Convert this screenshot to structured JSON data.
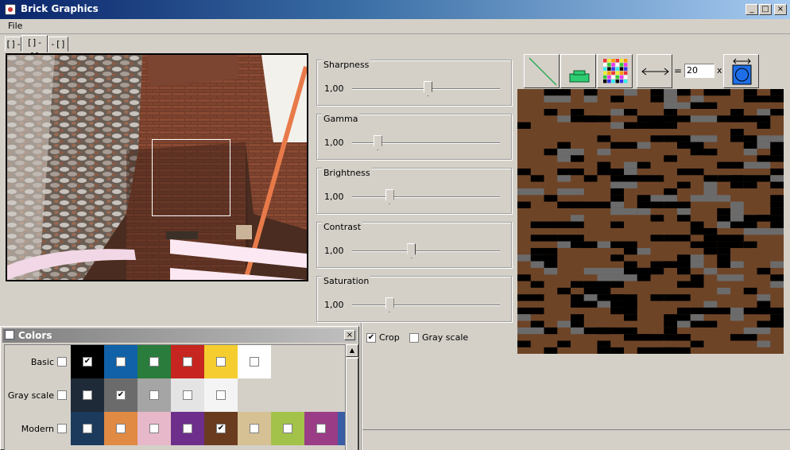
{
  "window": {
    "title": "Brick Graphics",
    "controls": {
      "minimize": "_",
      "maximize": "□",
      "close": "×"
    }
  },
  "menu": {
    "file": "File"
  },
  "tabs": [
    {
      "label": "[]-",
      "active": false
    },
    {
      "label": "[]-[]",
      "active": true
    },
    {
      "label": "-[]",
      "active": false
    }
  ],
  "sliders": [
    {
      "label": "Sharpness",
      "value": "1,00",
      "position": 0.51
    },
    {
      "label": "Gamma",
      "value": "1,00",
      "position": 0.17
    },
    {
      "label": "Brightness",
      "value": "1,00",
      "position": 0.25
    },
    {
      "label": "Contrast",
      "value": "1,00",
      "position": 0.4
    },
    {
      "label": "Saturation",
      "value": "1,00",
      "position": 0.25
    }
  ],
  "options": {
    "crop": {
      "label": "Crop",
      "checked": true
    },
    "grayscale": {
      "label": "Gray scale",
      "checked": false
    }
  },
  "toolbar": {
    "equals": "=",
    "size_value": "20",
    "x_label": "x",
    "icons": [
      "diagonal-line-icon",
      "single-brick-icon",
      "color-grid-icon",
      "horizontal-arrow-icon",
      "round-tile-icon"
    ]
  },
  "colors_panel": {
    "title": "Colors",
    "close": "×",
    "scroll_up": "▲",
    "groups": [
      {
        "label": "Basic",
        "checked": false,
        "swatches": [
          {
            "color": "#000000",
            "checked": true
          },
          {
            "color": "#1061a8",
            "checked": false
          },
          {
            "color": "#2a7c3c",
            "checked": false
          },
          {
            "color": "#c6261f",
            "checked": false
          },
          {
            "color": "#f5cd2f",
            "checked": false
          },
          {
            "color": "#ffffff",
            "checked": false
          }
        ]
      },
      {
        "label": "Gray scale",
        "checked": false,
        "swatches": [
          {
            "color": "#1e2a38",
            "checked": false
          },
          {
            "color": "#6b6b6b",
            "checked": true
          },
          {
            "color": "#a5a5a5",
            "checked": false
          },
          {
            "color": "#e4e4e4",
            "checked": false
          },
          {
            "color": "#f4f4f4",
            "checked": false
          }
        ]
      },
      {
        "label": "Modern",
        "checked": false,
        "swatches": [
          {
            "color": "#1b3a5c",
            "checked": false
          },
          {
            "color": "#e08a43",
            "checked": false
          },
          {
            "color": "#e7b8c9",
            "checked": false
          },
          {
            "color": "#6d2f8b",
            "checked": false
          },
          {
            "color": "#6a3b1f",
            "checked": true
          },
          {
            "color": "#d6c195",
            "checked": false
          },
          {
            "color": "#a2c24a",
            "checked": false
          },
          {
            "color": "#9a3d86",
            "checked": false
          },
          {
            "color": "#3b5da6",
            "checked": false
          }
        ]
      }
    ]
  }
}
